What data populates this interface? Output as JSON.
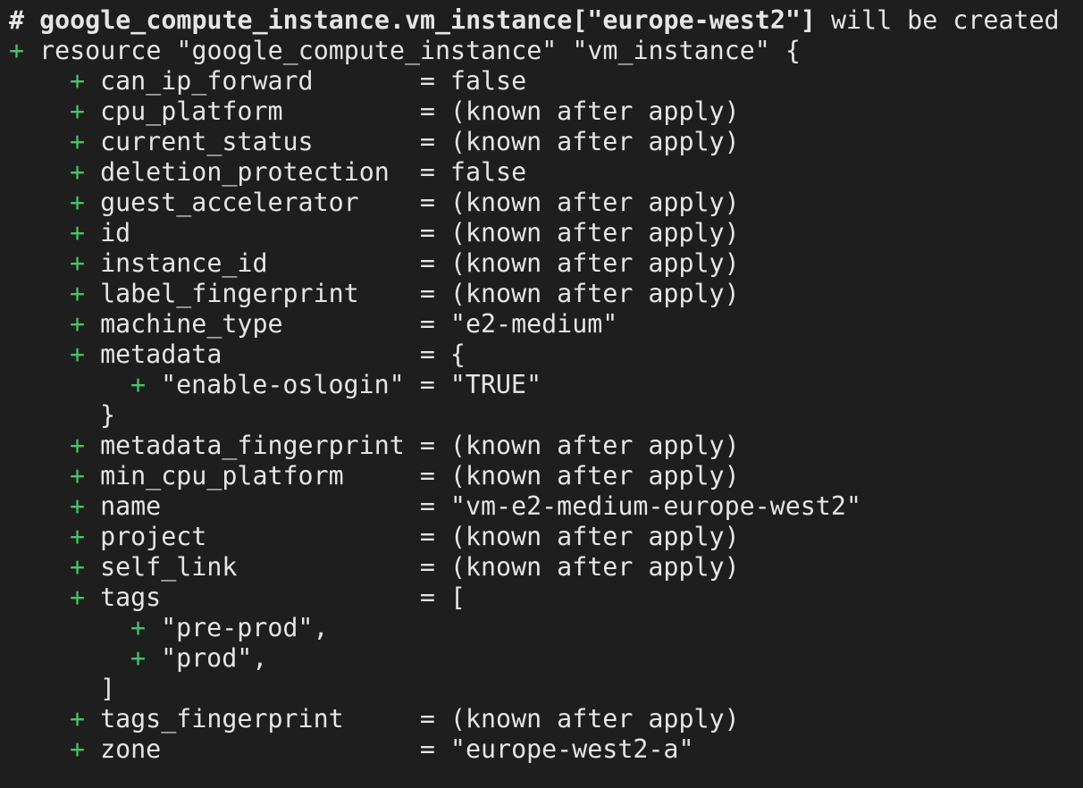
{
  "header": {
    "hash": "# ",
    "resource_address": "google_compute_instance.vm_instance[\"europe-west2\"]",
    "action": " will be created"
  },
  "resource_line": {
    "text": "resource \"google_compute_instance\" \"vm_instance\" {"
  },
  "symbols": {
    "plus": "+ "
  },
  "attributes": [
    {
      "key": "can_ip_forward       ",
      "op": "= ",
      "value": "false"
    },
    {
      "key": "cpu_platform         ",
      "op": "= ",
      "value": "(known after apply)"
    },
    {
      "key": "current_status       ",
      "op": "= ",
      "value": "(known after apply)"
    },
    {
      "key": "deletion_protection  ",
      "op": "= ",
      "value": "false"
    },
    {
      "key": "guest_accelerator    ",
      "op": "= ",
      "value": "(known after apply)"
    },
    {
      "key": "id                   ",
      "op": "= ",
      "value": "(known after apply)"
    },
    {
      "key": "instance_id          ",
      "op": "= ",
      "value": "(known after apply)"
    },
    {
      "key": "label_fingerprint    ",
      "op": "= ",
      "value": "(known after apply)"
    },
    {
      "key": "machine_type         ",
      "op": "= ",
      "value": "\"e2-medium\""
    },
    {
      "key": "metadata             ",
      "op": "= ",
      "value": "{"
    }
  ],
  "metadata_block": {
    "entry": "\"enable-oslogin\" = \"TRUE\"",
    "close": "}"
  },
  "attributes_2": [
    {
      "key": "metadata_fingerprint ",
      "op": "= ",
      "value": "(known after apply)"
    },
    {
      "key": "min_cpu_platform     ",
      "op": "= ",
      "value": "(known after apply)"
    },
    {
      "key": "name                 ",
      "op": "= ",
      "value": "\"vm-e2-medium-europe-west2\""
    },
    {
      "key": "project              ",
      "op": "= ",
      "value": "(known after apply)"
    },
    {
      "key": "self_link            ",
      "op": "= ",
      "value": "(known after apply)"
    },
    {
      "key": "tags                 ",
      "op": "= ",
      "value": "["
    }
  ],
  "tags_block": {
    "items": [
      "\"pre-prod\",",
      "\"prod\","
    ],
    "close": "]"
  },
  "attributes_3": [
    {
      "key": "tags_fingerprint     ",
      "op": "= ",
      "value": "(known after apply)"
    },
    {
      "key": "zone                 ",
      "op": "= ",
      "value": "\"europe-west2-a\""
    }
  ],
  "colors": {
    "background": "#1e1e1e",
    "text": "#e5e5e5",
    "plus": "#49c26b"
  }
}
